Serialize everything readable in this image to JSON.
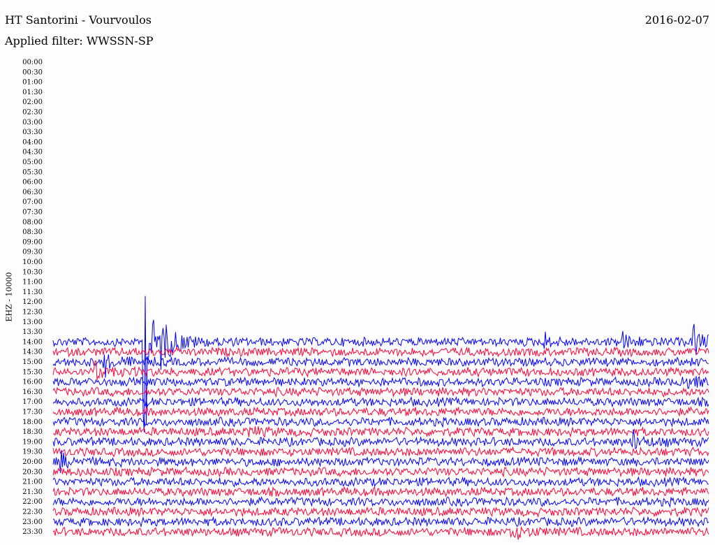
{
  "header": {
    "station": "HT Santorini - Vourvoulos",
    "date": "2016-02-07",
    "filter_label": "Applied filter:",
    "filter_value": "WWSSN-SP"
  },
  "chart_data": {
    "type": "line",
    "title": "HT Santorini - Vourvoulos",
    "ylabel": "EHZ - 10000",
    "x_unit": "minutes within 30-minute row",
    "xlim": [
      0,
      30
    ],
    "rows": [
      "00:00",
      "00:30",
      "01:00",
      "01:30",
      "02:00",
      "02:30",
      "03:00",
      "03:30",
      "04:00",
      "04:30",
      "05:00",
      "05:30",
      "06:00",
      "06:30",
      "07:00",
      "07:30",
      "08:00",
      "08:30",
      "09:00",
      "09:30",
      "10:00",
      "10:30",
      "11:00",
      "11:30",
      "12:00",
      "12:30",
      "13:00",
      "13:30",
      "14:00",
      "14:30",
      "15:00",
      "15:30",
      "16:00",
      "16:30",
      "17:00",
      "17:30",
      "18:00",
      "18:30",
      "19:00",
      "19:30",
      "20:00",
      "20:30",
      "21:00",
      "21:30",
      "22:00",
      "22:30",
      "23:00",
      "23:30"
    ],
    "first_trace_row": 28,
    "colors": [
      "#0000ff",
      "#ff0033"
    ],
    "events": [
      {
        "row": "14:00",
        "minute": 4.2,
        "peak": 9.0
      },
      {
        "row": "14:00",
        "minute": 5.0,
        "peak": 1.5
      },
      {
        "row": "14:00",
        "minute": 22.5,
        "peak": 0.8
      },
      {
        "row": "14:00",
        "minute": 26.0,
        "peak": 1.2
      },
      {
        "row": "14:00",
        "minute": 29.3,
        "peak": 2.2
      },
      {
        "row": "15:00",
        "minute": 2.3,
        "peak": 1.4
      },
      {
        "row": "15:30",
        "minute": 2.0,
        "peak": 1.0
      },
      {
        "row": "16:00",
        "minute": 28.8,
        "peak": 1.4
      },
      {
        "row": "18:30",
        "minute": 9.0,
        "peak": 0.7
      },
      {
        "row": "19:00",
        "minute": 26.5,
        "peak": 1.2
      },
      {
        "row": "20:00",
        "minute": 0.4,
        "peak": 0.9
      },
      {
        "row": "23:30",
        "minute": 21.0,
        "peak": 1.4
      }
    ]
  }
}
